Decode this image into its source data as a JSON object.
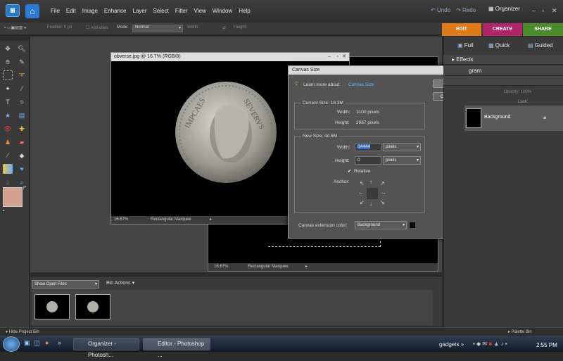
{
  "menubar": {
    "items": [
      "File",
      "Edit",
      "Image",
      "Enhance",
      "Layer",
      "Select",
      "Filter",
      "View",
      "Window",
      "Help"
    ],
    "undo": "Undo",
    "redo": "Redo",
    "organizer": "Organizer"
  },
  "options": {
    "feather_label": "Feather:",
    "feather_value": "0 px",
    "antialias": "Anti-alias",
    "mode_label": "Mode:",
    "mode_value": "Normal",
    "width_label": "Width:",
    "height_label": "Height:"
  },
  "tabs": {
    "edit": "EDIT",
    "create": "CREATE",
    "share": "SHARE"
  },
  "edit_modes": {
    "full": "Full",
    "quick": "Quick",
    "guided": "Guided"
  },
  "panels": {
    "effects": "Effects",
    "histogram": "gram",
    "opacity_label": "Opacity:",
    "opacity_value": "100%",
    "lock_label": "Lock:",
    "layer_name": "Background"
  },
  "doc1": {
    "title": "obverse.jpg @ 16.7% (RGB/8)",
    "zoom": "16.67%",
    "tool": "Rectangular Marquee"
  },
  "doc2": {
    "zoom": "16.67%",
    "tool": "Rectangular Marquee"
  },
  "dialog": {
    "title": "Canvas Size",
    "learn": "Learn more about:",
    "learn_link": "Canvas Size",
    "ok": "OK",
    "cancel": "Cancel",
    "current_size": "Current Size: 18.3M",
    "cur_width_label": "Width:",
    "cur_width_value": "3100 pixels",
    "cur_height_label": "Height:",
    "cur_height_value": "2067 pixels",
    "new_size": "New Size: 44.6M",
    "width_label": "Width:",
    "width_value": "04444",
    "height_label": "Height:",
    "height_value": "0",
    "unit": "pixels",
    "relative": "Relative",
    "anchor": "Anchor:",
    "ext_color_label": "Canvas extension color:",
    "ext_color_value": "Background"
  },
  "bin": {
    "show": "Show Open Files",
    "actions": "Bin Actions",
    "hide": "Hide Project Bin",
    "palette": "Palette Bin"
  },
  "taskbar": {
    "task1": "Organizer - Photosh...",
    "task2": "Editor - Photoshop ...",
    "gadgets": "gadgets",
    "time": "2:55 PM"
  },
  "colors": {
    "foreground": "#d2a190",
    "background": "#111111",
    "edit_tab": "#e07918",
    "create_tab": "#b1246a",
    "share_tab": "#4c8b2b"
  }
}
